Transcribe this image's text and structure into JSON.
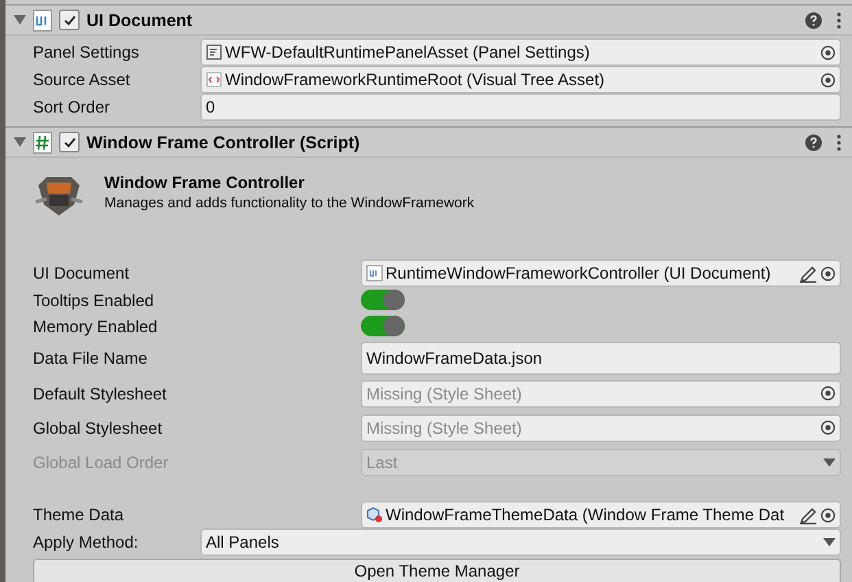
{
  "components": [
    {
      "kind": "ui",
      "title": "UI Document",
      "expanded": true,
      "enabled": true,
      "fields": [
        {
          "kind": "panel-asset",
          "label": "Panel Settings",
          "value": "WFW-DefaultRuntimePanelAsset (Panel Settings)"
        },
        {
          "kind": "tree-asset",
          "label": "Source Asset",
          "value": "WindowFrameworkRuntimeRoot (Visual Tree Asset)"
        },
        {
          "kind": "text",
          "label": "Sort Order",
          "value": "0"
        }
      ]
    },
    {
      "kind": "script",
      "title": "Window Frame Controller (Script)",
      "expanded": true,
      "enabled": true,
      "info": {
        "title": "Window Frame Controller",
        "description": "Manages and adds functionality to the WindowFramework"
      },
      "fields": [
        {
          "kind": "ui-asset",
          "label": "UI Document",
          "value": "RuntimeWindowFrameworkController (UI Document)",
          "editable": true
        },
        {
          "kind": "toggle",
          "label": "Tooltips Enabled",
          "on": true
        },
        {
          "kind": "toggle",
          "label": "Memory Enabled",
          "on": true
        },
        {
          "kind": "text",
          "label": "Data File Name",
          "value": "WindowFrameData.json"
        },
        {
          "kind": "missing-asset",
          "label": "Default Stylesheet",
          "value": "Missing (Style Sheet)"
        },
        {
          "kind": "missing-asset",
          "label": "Global Stylesheet",
          "value": "Missing (Style Sheet)"
        },
        {
          "kind": "dropdown",
          "label": "Global Load Order",
          "value": "Last",
          "disabled": true
        },
        {
          "kind": "space"
        },
        {
          "kind": "theme-asset",
          "label": "Theme Data",
          "value": "WindowFrameThemeData (Window Frame Theme Dat",
          "editable": true
        },
        {
          "kind": "dropdown",
          "label": "Apply Method:",
          "value": "All Panels",
          "disabled": false,
          "narrow": true
        },
        {
          "kind": "button",
          "label": "Open Theme Manager"
        }
      ]
    }
  ]
}
